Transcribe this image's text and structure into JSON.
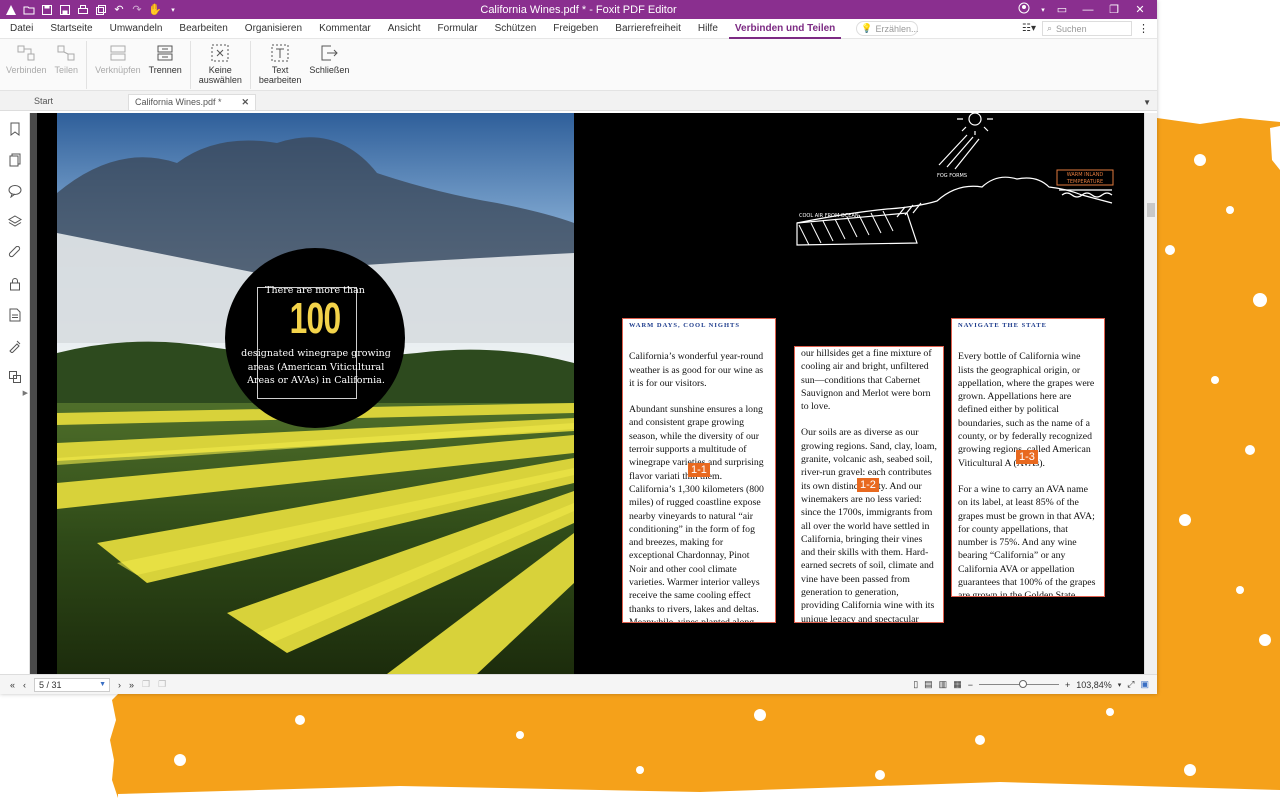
{
  "window": {
    "title": "California Wines.pdf * - Foxit PDF Editor"
  },
  "menu": {
    "tabs": [
      "Datei",
      "Startseite",
      "Umwandeln",
      "Bearbeiten",
      "Organisieren",
      "Kommentar",
      "Ansicht",
      "Formular",
      "Schützen",
      "Freigeben",
      "Barrierefreiheit",
      "Hilfe",
      "Verbinden und Teilen"
    ],
    "active_index": 12,
    "tell_me": "Erzählen...",
    "search_placeholder": "Suchen"
  },
  "ribbon": {
    "connect": "Verbinden",
    "split_share": "Teilen",
    "link": "Verknüpfen",
    "separate": "Trennen",
    "none_select_1": "Keine",
    "none_select_2": "auswählen",
    "edit_text_1": "Text",
    "edit_text_2": "bearbeiten",
    "close": "Schließen"
  },
  "doc_tabs": {
    "start": "Start",
    "active": "California Wines.pdf *"
  },
  "document": {
    "circle_pre": "There are more than",
    "circle_big": "100",
    "circle_post": "designated winegrape growing areas (American Viticultural Areas or AVAs) in California.",
    "illus_labels": {
      "fog": "FOG FORMS",
      "cool_air": "COOL AIR FROM OCEAN",
      "warm": "WARM INLAND",
      "temp": "TEMPERATURE"
    },
    "colA_kicker": "WARM DAYS, COOL NIGHTS",
    "colA_p1": "California’s wonderful year-round weather is as good for our wine as it is for our visitors.",
    "colA_p2": "Abundant sunshine ensures a long and consistent grape growing season, while the diversity of our terroir supports a multitude of winegrape varieties and surprising flavor variati      thin them. California’s 1,300 kilometers (800 miles) of rugged coastline expose nearby vineyards to natural “air conditioning” in the form of fog and breezes, making for exceptional Chardonnay, Pinot Noir and other cool climate varieties. Warmer interior valleys receive the same cooling effect thanks to rivers, lakes and deltas. Meanwhile, vines planted along",
    "marker_a": "1-1",
    "colB_p1": "our hillsides get a fine mixture of cooling air and bright, unfiltered sun—conditions that Cabernet Sauvignon and Merlot were born to love.",
    "colB_p2": "Our soils are as diverse as our growing regions. Sand, clay, loam, granite, volcanic ash, seabed soil, river-run gravel: each contributes its own distinc      erality. And our winemakers are no less varied: since the 1700s, immigrants from all over the world have settled in California, bringing their vines and their skills with them. Hard-earned secrets of soil, climate and vine have been passed from generation to generation, providing California wine with its unique legacy and spectacular range.",
    "marker_b": "1-2",
    "colC_kicker": "NAVIGATE THE STATE",
    "colC_p1": "Every bottle of California wine lists the geographical origin, or appellation, where the grapes were grown. Appellations here are defined either by political boundaries, such as the name of a county, or by federally recognized growing regions, called American Viticultural A      (AVAs).",
    "colC_p2": "For a wine to carry an AVA name on its label, at least 85% of the grapes must be grown in that AVA; for county appellations, that number is 75%. And any wine bearing “California” or any California AVA or appellation guarantees that 100% of the grapes are grown in the Golden State.",
    "marker_c": "1-3"
  },
  "status": {
    "page": "5 / 31",
    "zoom": "103,84%"
  },
  "colors": {
    "title_bar": "#8a2f8f",
    "accent": "#7c2a83",
    "orange": "#f5a11a",
    "marker": "#e8691f"
  }
}
